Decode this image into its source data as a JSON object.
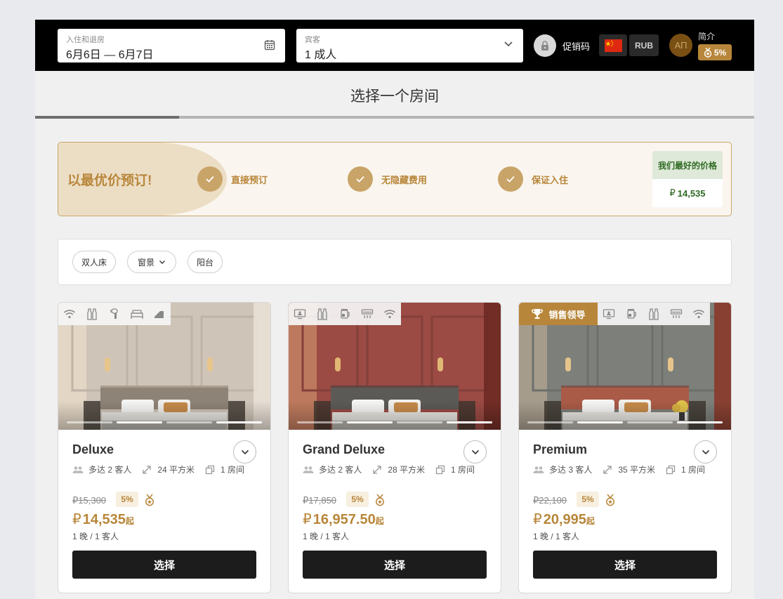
{
  "header": {
    "dates": {
      "label": "入住和退房",
      "value": "6月6日 — 6月7日"
    },
    "guests": {
      "label": "宾客",
      "value": "1 成人"
    },
    "promo_label": "促销码",
    "currency": "RUB",
    "avatar_initials": "АП",
    "profile_label": "简介",
    "discount": "5%"
  },
  "page": {
    "title": "选择一个房间",
    "progress": 0.2
  },
  "banner": {
    "title": "以最优价预订!",
    "perks": [
      "直接预订",
      "无隐藏费用",
      "保证入住"
    ],
    "best_price_label": "我们最好的价格",
    "best_price_currency": "₽",
    "best_price_value": "14,535"
  },
  "filters": [
    "双人床",
    "窗景",
    "阳台"
  ],
  "rooms": [
    {
      "name": "Deluxe",
      "guests": "多达 2 客人",
      "area": "24 平方米",
      "rooms": "1 房间",
      "old_price": "₽15,300",
      "discount": "5%",
      "currency": "₽",
      "price": "14,535",
      "from": "起",
      "per": "1 晚 / 1 客人",
      "select_label": "选择",
      "amenities": [
        "wifi-icon",
        "bottles-icon",
        "hairdryer-icon",
        "bed-icon",
        "slippers-icon"
      ]
    },
    {
      "name": "Grand Deluxe",
      "guests": "多达 2 客人",
      "area": "28 平方米",
      "rooms": "1 房间",
      "old_price": "₽17,850",
      "discount": "5%",
      "currency": "₽",
      "price": "16,957.50",
      "from": "起",
      "per": "1 晚 / 1 客人",
      "select_label": "选择",
      "amenities": [
        "tv-icon",
        "bottles-icon",
        "kettle-icon",
        "ac-icon",
        "wifi-icon"
      ]
    },
    {
      "name": "Premium",
      "badge": "销售领导",
      "guests": "多达 3 客人",
      "area": "35 平方米",
      "rooms": "1 房间",
      "old_price": "₽22,100",
      "discount": "5%",
      "currency": "₽",
      "price": "20,995",
      "from": "起",
      "per": "1 晚 / 1 客人",
      "select_label": "选择",
      "amenities": [
        "tv-icon",
        "kettle-icon",
        "bottles-icon",
        "ac-icon",
        "wifi-icon"
      ]
    }
  ],
  "colors": {
    "gold": "#b8863a",
    "green": "#2f6b23",
    "dark": "#1c1c1c"
  }
}
